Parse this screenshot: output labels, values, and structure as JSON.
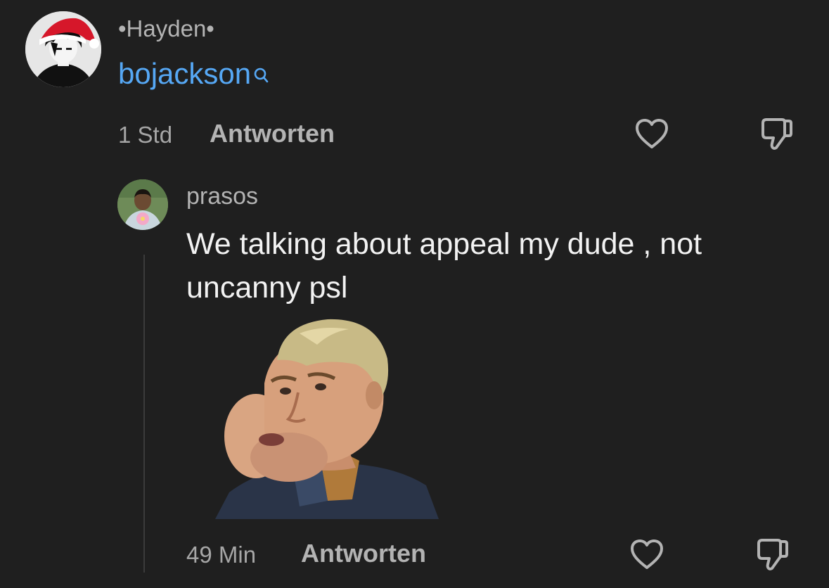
{
  "comment": {
    "username": "•Hayden•",
    "link_text": "bojackson",
    "time": "1 Std",
    "reply_label": "Antworten",
    "icons": [
      "heart-icon",
      "dislike-icon",
      "search-icon"
    ]
  },
  "reply": {
    "username": "prasos",
    "text": "We talking about appeal my dude , not uncanny psl",
    "time": "49 Min",
    "reply_label": "Antworten",
    "icons": [
      "heart-icon",
      "dislike-icon"
    ]
  },
  "colors": {
    "background": "#1f1f1f",
    "link": "#56a8f5",
    "muted": "#a6a6a6",
    "text": "#f2f2f2"
  }
}
